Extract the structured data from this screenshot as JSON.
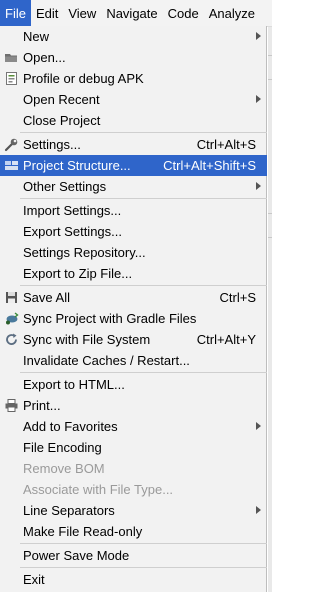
{
  "menubar": {
    "items": [
      "File",
      "Edit",
      "View",
      "Navigate",
      "Code",
      "Analyze"
    ],
    "active": "File"
  },
  "menu": {
    "items": [
      {
        "label": "New",
        "submenu": true
      },
      {
        "label": "Open...",
        "icon": "folder-icon"
      },
      {
        "label": "Profile or debug APK",
        "icon": "apk-icon"
      },
      {
        "label": "Open Recent",
        "submenu": true
      },
      {
        "label": "Close Project"
      },
      {
        "label": "Settings...",
        "shortcut": "Ctrl+Alt+S",
        "icon": "wrench-icon"
      },
      {
        "label": "Project Structure...",
        "shortcut": "Ctrl+Alt+Shift+S",
        "icon": "project-structure-icon",
        "selected": true
      },
      {
        "label": "Other Settings",
        "submenu": true
      },
      {
        "label": "Import Settings..."
      },
      {
        "label": "Export Settings..."
      },
      {
        "label": "Settings Repository..."
      },
      {
        "label": "Export to Zip File..."
      },
      {
        "label": "Save All",
        "shortcut": "Ctrl+S",
        "icon": "save-icon"
      },
      {
        "label": "Sync Project with Gradle Files",
        "icon": "gradle-sync-icon"
      },
      {
        "label": "Sync with File System",
        "shortcut": "Ctrl+Alt+Y",
        "icon": "refresh-icon"
      },
      {
        "label": "Invalidate Caches / Restart..."
      },
      {
        "label": "Export to HTML..."
      },
      {
        "label": "Print...",
        "icon": "printer-icon"
      },
      {
        "label": "Add to Favorites",
        "submenu": true
      },
      {
        "label": "File Encoding"
      },
      {
        "label": "Remove BOM",
        "disabled": true
      },
      {
        "label": "Associate with File Type...",
        "disabled": true
      },
      {
        "label": "Line Separators",
        "submenu": true
      },
      {
        "label": "Make File Read-only"
      },
      {
        "label": "Power Save Mode"
      },
      {
        "label": "Exit"
      }
    ]
  }
}
